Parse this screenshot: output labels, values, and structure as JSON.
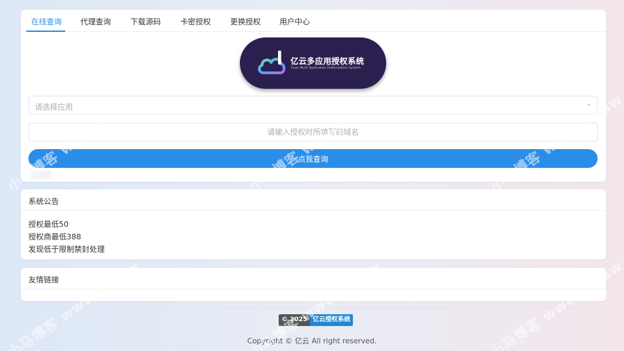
{
  "tabs": [
    {
      "label": "在线查询",
      "active": true
    },
    {
      "label": "代理查询",
      "active": false
    },
    {
      "label": "下载源码",
      "active": false
    },
    {
      "label": "卡密授权",
      "active": false
    },
    {
      "label": "更换授权",
      "active": false
    },
    {
      "label": "用户中心",
      "active": false
    }
  ],
  "logo": {
    "title": "亿云多应用授权系统",
    "subtitle": "Yiyun Multi Application Authorization System",
    "bg_color": "#2a1f4e"
  },
  "form": {
    "select_placeholder": "请选择应用",
    "domain_placeholder": "请输入授权时所填写的域名",
    "query_button": "点我查询"
  },
  "notice": {
    "title": "系统公告",
    "lines": [
      "授权最低50",
      "授权商最低388",
      "发现低于限制禁封处理"
    ]
  },
  "links": {
    "title": "友情链接"
  },
  "footer": {
    "badge_left": "© 2025",
    "badge_right": "亿云授权系统",
    "copyright": "Copyright © 亿云 All right reserved."
  },
  "colors": {
    "accent": "#2b8de8",
    "badge_right": "#1e88d6",
    "badge_left": "#555555"
  },
  "watermark": "小马博客 www.xmaw"
}
